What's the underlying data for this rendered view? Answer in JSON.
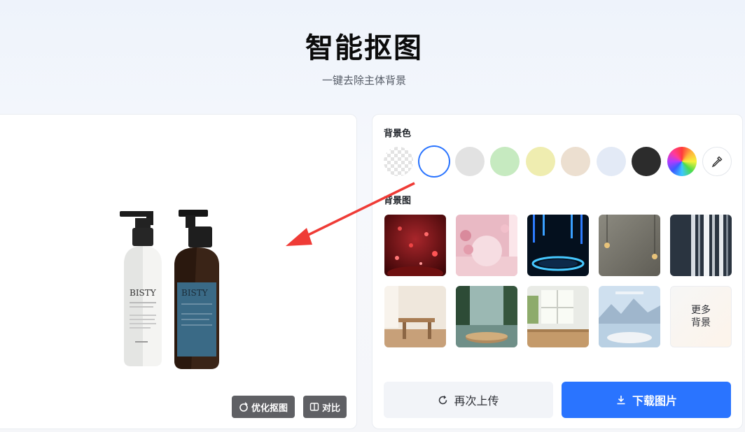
{
  "header": {
    "title": "智能抠图",
    "subtitle": "一键去除主体背景"
  },
  "preview": {
    "product_label": "BISTY",
    "refine_label": "优化抠图",
    "compare_label": "对比"
  },
  "settings": {
    "bg_color_label": "背景色",
    "bg_image_label": "背景图",
    "colors": [
      "transparent",
      "#ffffff",
      "#e2e2e2",
      "#c6eac0",
      "#efedb0",
      "#ecdfd0",
      "#e3eaf6",
      "#2c2c2c",
      "rainbow",
      "picker"
    ],
    "selected_color": "#ffffff",
    "more_line1": "更多",
    "more_line2": "背景",
    "reupload_label": "再次上传",
    "download_label": "下载图片",
    "accent": "#2a74ff"
  }
}
